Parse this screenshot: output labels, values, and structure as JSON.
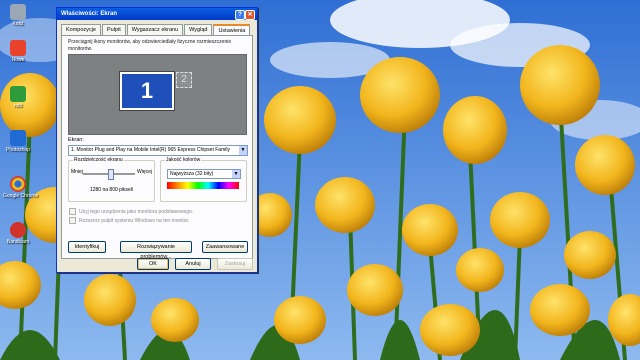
{
  "desktop": {
    "icons": [
      {
        "label": "Kosz",
        "color": "#9aa7b5"
      },
      {
        "label": "Nowe",
        "color": "#e8412c"
      },
      {
        "label": "rotti",
        "color": "#2e9c3a"
      },
      {
        "label": "Photoshop",
        "color": "#1f6bd1"
      },
      {
        "label": "Google Chrome",
        "color": "#e3bb1f"
      },
      {
        "label": "Bandicam",
        "color": "#d1332b"
      }
    ]
  },
  "dialog": {
    "title": "Właściwości: Ekran",
    "help_glyph": "?",
    "close_glyph": "✕",
    "tabs": [
      "Kompozycje",
      "Pulpit",
      "Wygaszacz ekranu",
      "Wygląd",
      "Ustawienia"
    ],
    "active_tab_index": 4,
    "description": "Przeciągnij ikony monitorów, aby odzwierciedlały fizyczne rozmieszczenie monitorów.",
    "monitors": [
      {
        "number": "1",
        "active": true
      },
      {
        "number": "2",
        "active": false
      }
    ],
    "display_label": "Ekran:",
    "display_value": "1. Monitor Plug and Play na Mobile Intel(R) 965 Express Chipset Family",
    "resolution": {
      "title": "Rozdzielczość ekranu",
      "less_label": "Mniej",
      "more_label": "Więcej",
      "slider_fraction": 0.55,
      "value": "1280 na 800 pikseli"
    },
    "color_quality": {
      "title": "Jakość kolorów",
      "value": "Najwyższa (32 bity)"
    },
    "checkboxes": [
      "Użyj tego urządzenia jako monitora podstawowego.",
      "Rozszerz pulpit systemu Windows na ten monitor."
    ],
    "buttons": {
      "identify": "Identyfikuj",
      "troubleshoot": "Rozwiązywanie problemów...",
      "advanced": "Zaawansowane",
      "ok": "OK",
      "cancel": "Anuluj",
      "apply": "Zastosuj"
    }
  }
}
